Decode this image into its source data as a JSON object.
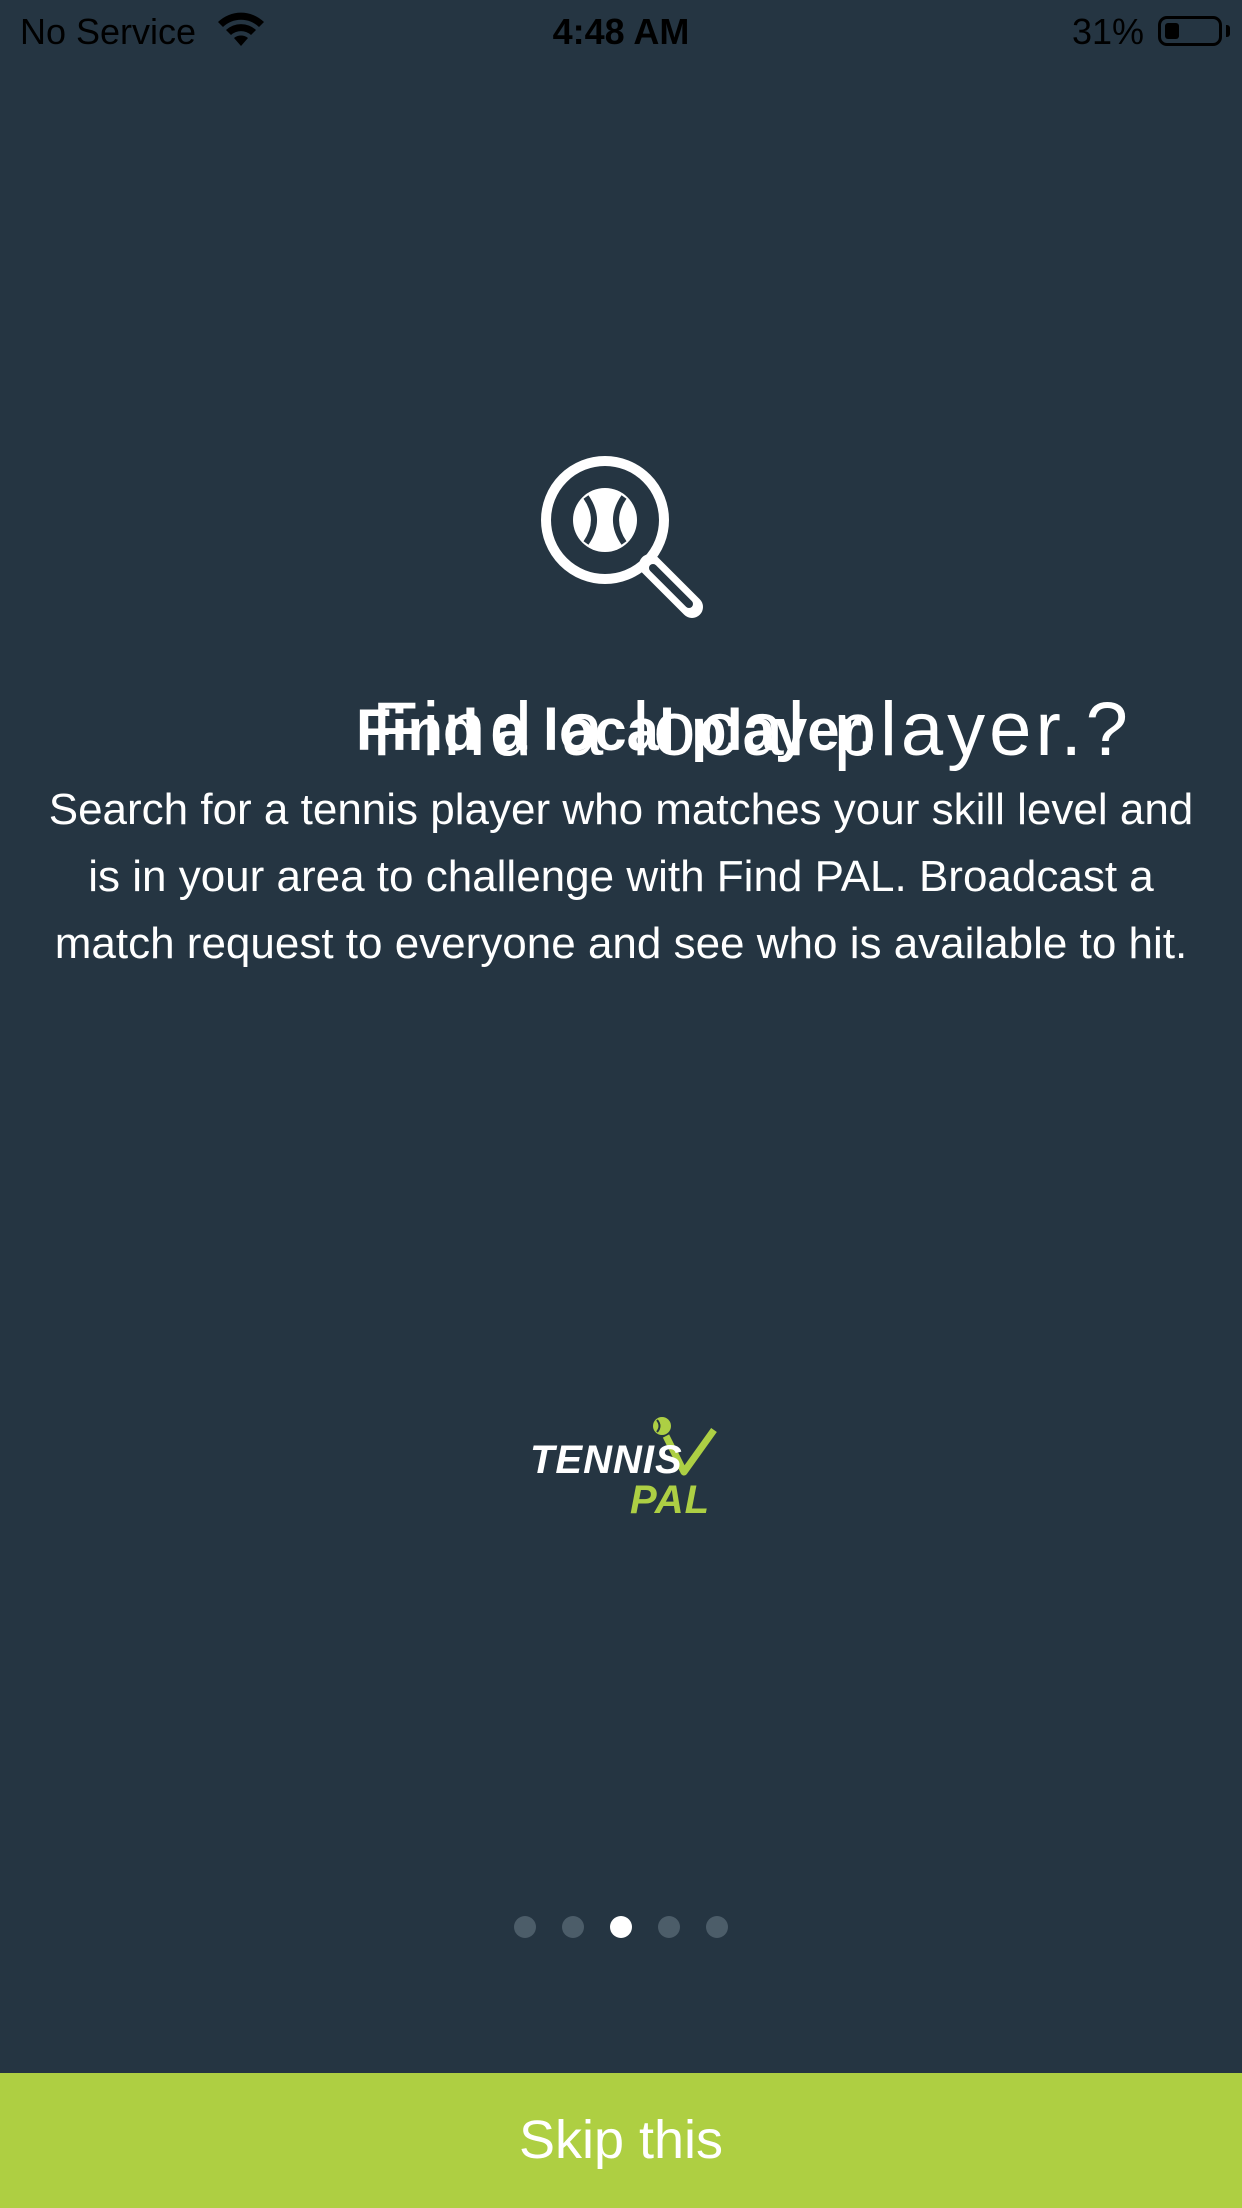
{
  "status_bar": {
    "carrier": "No Service",
    "time": "4:48 AM",
    "battery_percent": "31%",
    "wifi_icon": "wifi-icon",
    "battery_icon": "battery-icon",
    "battery_level": 0.31
  },
  "onboarding": {
    "icon": "magnifier-tennis-ball-icon",
    "title_overlay": "Find a local player.?",
    "title": "Find a local player.",
    "description": "Search for a tennis player who matches your skill level and is in your area to challenge with Find PAL. Broadcast a match request to everyone and see who is available to hit."
  },
  "logo": {
    "line1": "TENNIS",
    "line2": "PAL",
    "accent_color": "#adcf44"
  },
  "pager": {
    "total": 5,
    "active_index": 2
  },
  "skip_button": {
    "label": "Skip this"
  },
  "colors": {
    "background": "#253542",
    "accent": "#aecf42",
    "inactive_dot": "#4c5d69"
  }
}
